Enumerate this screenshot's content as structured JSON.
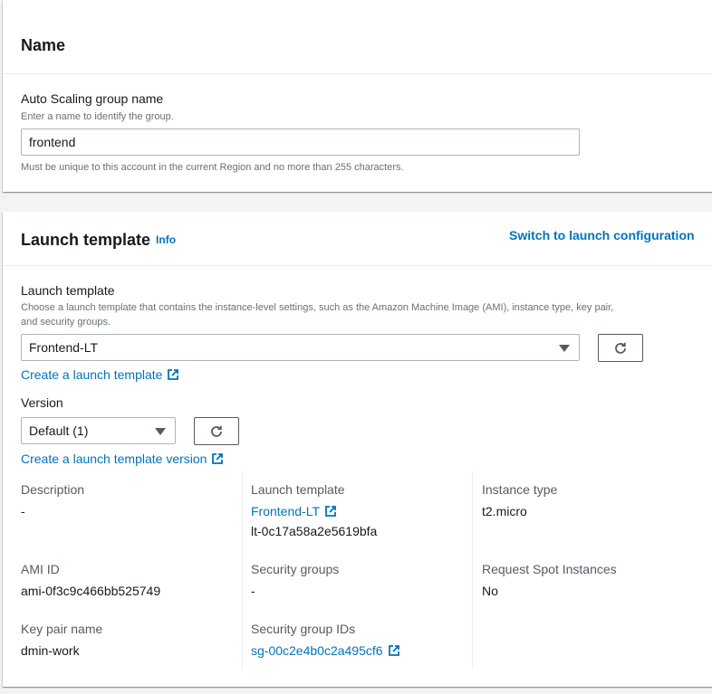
{
  "name_section": {
    "title": "Name",
    "asg_label": "Auto Scaling group name",
    "asg_desc": "Enter a name to identify the group.",
    "asg_value": "frontend",
    "asg_hint": "Must be unique to this account in the current Region and no more than 255 characters."
  },
  "launch_section": {
    "title": "Launch template",
    "info": "Info",
    "switch_link": "Switch to launch configuration",
    "lt_label": "Launch template",
    "lt_desc_1": "Choose a launch template that contains the instance-level settings, such as the Amazon Machine Image (AMI), instance type, key pair,",
    "lt_desc_2": "and security groups.",
    "lt_selected": "Frontend-LT",
    "create_lt_link": "Create a launch template",
    "version_label": "Version",
    "version_selected": "Default (1)",
    "create_version_link": "Create a launch template version"
  },
  "details": {
    "description_label": "Description",
    "description_value": "-",
    "lt_label": "Launch template",
    "lt_link": "Frontend-LT",
    "lt_id": "lt-0c17a58a2e5619bfa",
    "instance_type_label": "Instance type",
    "instance_type_value": "t2.micro",
    "ami_label": "AMI ID",
    "ami_value": "ami-0f3c9c466bb525749",
    "sg_label": "Security groups",
    "sg_value": "-",
    "spot_label": "Request Spot Instances",
    "spot_value": "No",
    "keypair_label": "Key pair name",
    "keypair_value": "dmin-work",
    "sgid_label": "Security group IDs",
    "sgid_value": "sg-00c2e4b0c2a495cf6"
  }
}
